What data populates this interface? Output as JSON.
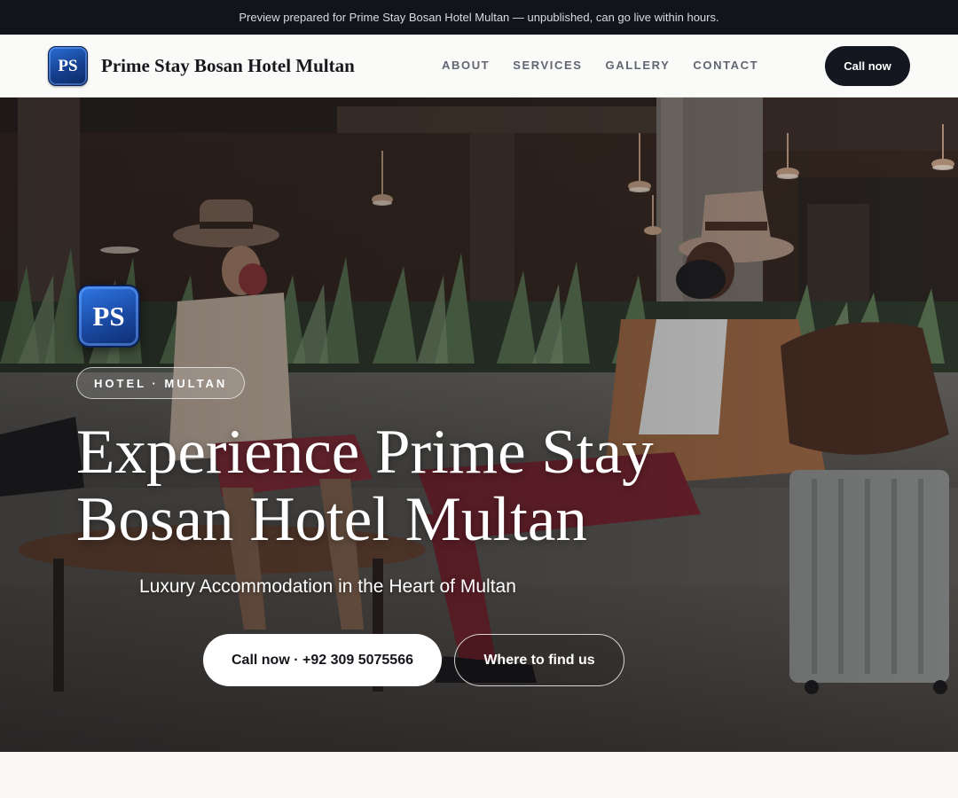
{
  "preview_banner": {
    "text": "Preview prepared for Prime Stay Bosan Hotel Multan — unpublished, can go live within hours."
  },
  "nav": {
    "logo_initials": "PS",
    "brand_name": "Prime Stay Bosan Hotel Multan",
    "links": [
      "ABOUT",
      "SERVICES",
      "GALLERY",
      "CONTACT"
    ],
    "cta_label": "Call now"
  },
  "hero": {
    "logo_initials": "PS",
    "tag": "HOTEL · MULTAN",
    "title": "Experience Prime Stay Bosan Hotel Multan",
    "subtitle": "Luxury Accommodation in the Heart of Multan",
    "primary_button": "Call now · +92 309 5075566",
    "secondary_button": "Where to find us",
    "background_description_icon": "hotel-lobby-photo"
  },
  "colors": {
    "banner_bg": "#11141a",
    "nav_bg": "#fafaf8",
    "cta_bg": "#141720",
    "logo_blue": "#1a4aa3",
    "page_bg": "#faf9f6"
  }
}
